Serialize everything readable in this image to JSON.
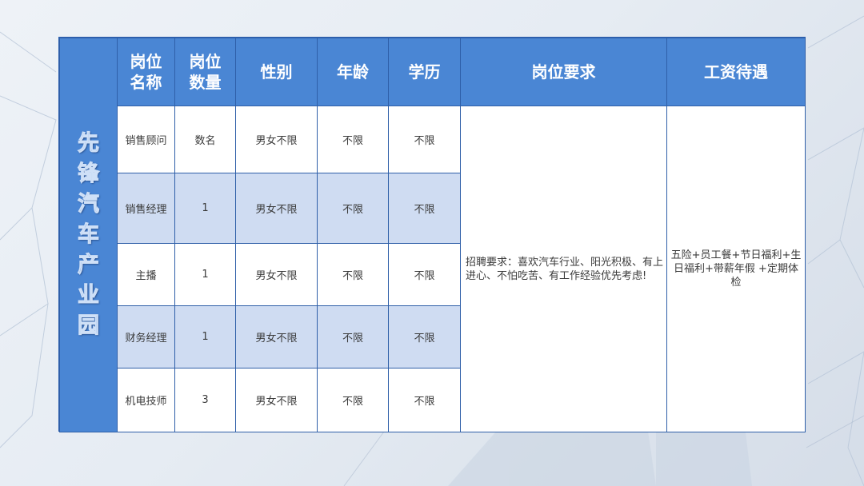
{
  "company_name": "先锋汽车产业园",
  "headers": {
    "position_name": "岗位名称",
    "headcount": "岗位数量",
    "gender": "性别",
    "age": "年龄",
    "education": "学历",
    "requirements": "岗位要求",
    "salary": "工资待遇"
  },
  "rows": [
    {
      "position": "销售顾问",
      "count": "数名",
      "gender": "男女不限",
      "age": "不限",
      "education": "不限"
    },
    {
      "position": "销售经理",
      "count": "1",
      "gender": "男女不限",
      "age": "不限",
      "education": "不限"
    },
    {
      "position": "主播",
      "count": "1",
      "gender": "男女不限",
      "age": "不限",
      "education": "不限"
    },
    {
      "position": "财务经理",
      "count": "1",
      "gender": "男女不限",
      "age": "不限",
      "education": "不限"
    },
    {
      "position": "机电技师",
      "count": "3",
      "gender": "男女不限",
      "age": "不限",
      "education": "不限"
    }
  ],
  "requirements_text": "招聘要求：喜欢汽车行业、阳光积极、有上进心、不怕吃苦、有工作经验优先考虑!",
  "salary_text": "五险+员工餐+节日福利+生日福利+带薪年假 +定期体检",
  "colors": {
    "header_blue": "#4a86d4",
    "alt_row": "#cfdcf2",
    "border": "#2f5fa8"
  }
}
